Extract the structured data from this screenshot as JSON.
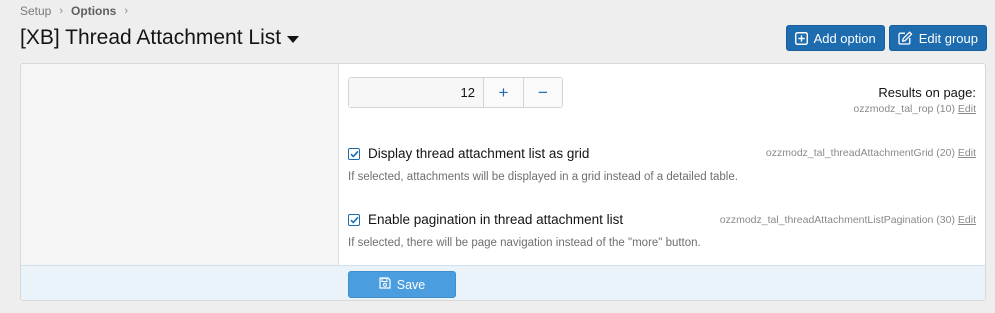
{
  "breadcrumb": {
    "items": [
      "Setup",
      "Options"
    ],
    "separator": "›"
  },
  "page": {
    "title": "[XB] Thread Attachment List"
  },
  "actions": {
    "add_option": "Add option",
    "edit_group": "Edit group"
  },
  "options": {
    "results_on_page": {
      "label": "Results on page:",
      "meta": "ozzmodz_tal_rop (10)",
      "edit": "Edit",
      "value": "12",
      "plus": "+",
      "minus": "−"
    },
    "grid": {
      "meta": "ozzmodz_tal_threadAttachmentGrid (20)",
      "edit": "Edit",
      "checked": true,
      "label": "Display thread attachment list as grid",
      "explain": "If selected, attachments will be displayed in a grid instead of a detailed table."
    },
    "pagination": {
      "meta": "ozzmodz_tal_threadAttachmentListPagination (30)",
      "edit": "Edit",
      "checked": true,
      "label": "Enable pagination in thread attachment list",
      "explain": "If selected, there will be page navigation instead of the \"more\" button."
    }
  },
  "footer": {
    "save": "Save"
  },
  "colors": {
    "primary": "#1d6cb0",
    "save_button": "#4a9ee0",
    "footer_bg": "#eaf3fa"
  }
}
